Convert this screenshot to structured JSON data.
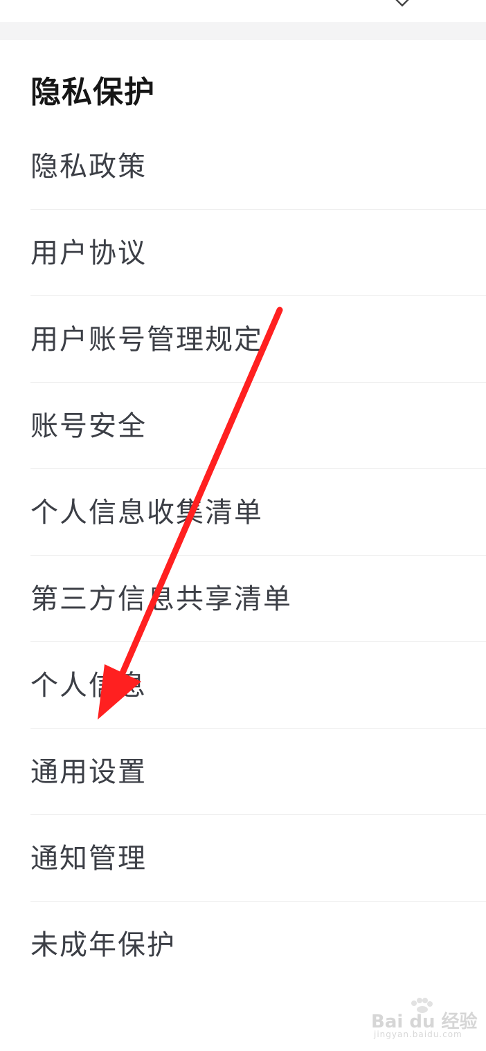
{
  "section": {
    "title": "隐私保护"
  },
  "menu": {
    "items": [
      {
        "label": "隐私政策"
      },
      {
        "label": "用户协议"
      },
      {
        "label": "用户账号管理规定"
      },
      {
        "label": "账号安全"
      },
      {
        "label": "个人信息收集清单"
      },
      {
        "label": "第三方信息共享清单"
      },
      {
        "label": "个人信息"
      },
      {
        "label": "通用设置"
      },
      {
        "label": "通知管理"
      },
      {
        "label": "未成年保护"
      }
    ]
  },
  "annotation": {
    "color": "#ff2020"
  },
  "watermark": {
    "logo_text": "Bai du 经验",
    "url_text": "jingyan.baidu.com"
  }
}
